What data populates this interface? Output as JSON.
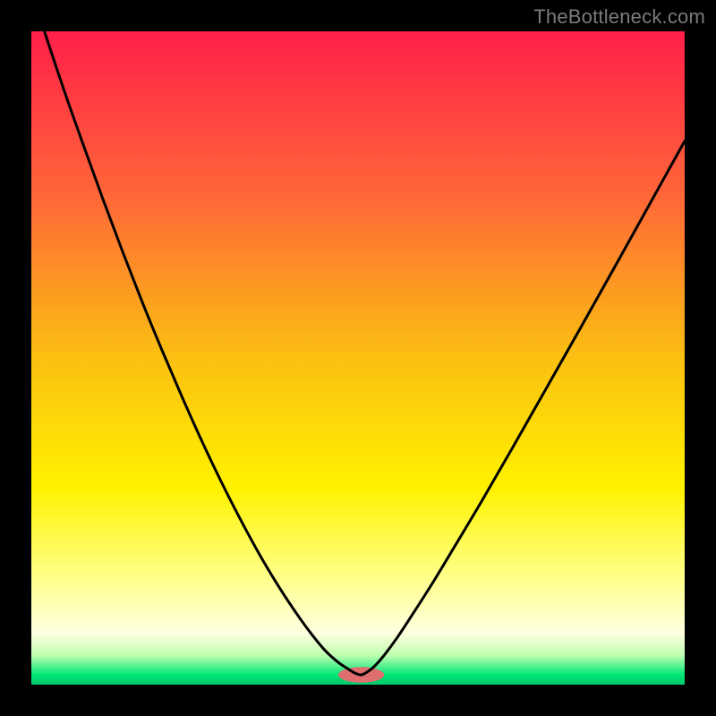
{
  "watermark": "TheBottleneck.com",
  "chart_data": {
    "type": "line",
    "title": "",
    "xlabel": "",
    "ylabel": "",
    "xlim": [
      0,
      1
    ],
    "ylim": [
      0,
      1
    ],
    "legend": false,
    "grid": false,
    "axes_visible": false,
    "background": {
      "type": "vertical-gradient",
      "stops": [
        {
          "pos": 0.0,
          "color": "#ff1f49"
        },
        {
          "pos": 0.25,
          "color": "#ff6638"
        },
        {
          "pos": 0.5,
          "color": "#fbc011"
        },
        {
          "pos": 0.7,
          "color": "#fff200"
        },
        {
          "pos": 0.82,
          "color": "#ffff7a"
        },
        {
          "pos": 0.92,
          "color": "#ffffe0"
        },
        {
          "pos": 0.955,
          "color": "#bfffb0"
        },
        {
          "pos": 0.985,
          "color": "#00e676"
        },
        {
          "pos": 1.0,
          "color": "#00c86e"
        }
      ]
    },
    "marker": {
      "x": 0.505,
      "y": 0.985,
      "rx": 0.035,
      "ry": 0.012,
      "color": "#e06e6e"
    },
    "series": [
      {
        "name": "curve",
        "stroke": "#000000",
        "stroke_width": 3,
        "min_x": 0.505,
        "x": [
          0.02,
          0.05,
          0.08,
          0.11,
          0.14,
          0.17,
          0.2,
          0.23,
          0.26,
          0.29,
          0.32,
          0.35,
          0.38,
          0.41,
          0.43,
          0.45,
          0.47,
          0.485,
          0.495,
          0.505,
          0.515,
          0.525,
          0.54,
          0.56,
          0.585,
          0.615,
          0.65,
          0.69,
          0.735,
          0.785,
          0.84,
          0.9,
          0.96,
          1.0
        ],
        "y": [
          0.0,
          0.09,
          0.175,
          0.258,
          0.338,
          0.415,
          0.488,
          0.558,
          0.625,
          0.688,
          0.747,
          0.802,
          0.852,
          0.897,
          0.924,
          0.948,
          0.966,
          0.976,
          0.982,
          0.985,
          0.98,
          0.972,
          0.955,
          0.928,
          0.89,
          0.843,
          0.785,
          0.718,
          0.64,
          0.552,
          0.455,
          0.348,
          0.24,
          0.168
        ]
      }
    ]
  }
}
